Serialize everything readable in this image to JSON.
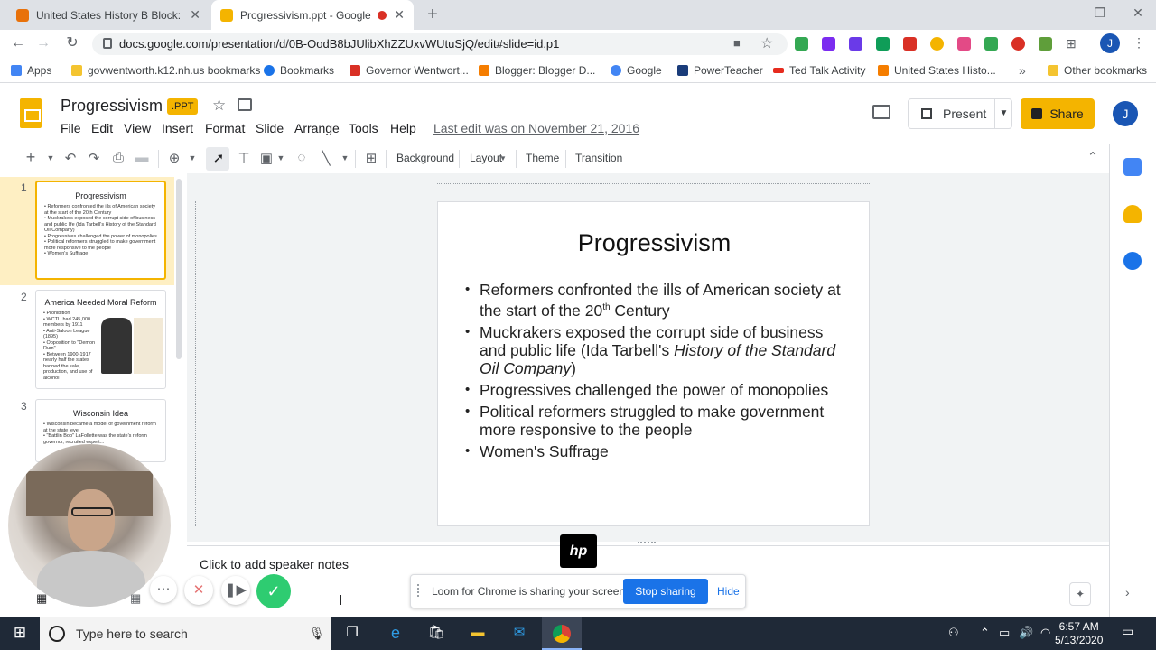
{
  "browser": {
    "tabs": [
      {
        "title": "United States History B Block: We",
        "favicon_color": "#e8710a"
      },
      {
        "title": "Progressivism.ppt - Google S",
        "favicon_color": "#f4b400"
      }
    ],
    "url": "docs.google.com/presentation/d/0B-OodB8bJUlibXhZZUxvWUtuSjQ/edit#slide=id.p1",
    "bookmarks": [
      {
        "label": "Apps",
        "icon": "apps-grid-icon"
      },
      {
        "label": "govwentworth.k12.nh.us bookmarks",
        "icon": "folder-icon"
      },
      {
        "label": "Bookmarks",
        "icon": "star-icon"
      },
      {
        "label": "Governor Wentwort...",
        "icon": "gmail-icon"
      },
      {
        "label": "Blogger: Blogger D...",
        "icon": "blogger-icon"
      },
      {
        "label": "Google",
        "icon": "google-icon"
      },
      {
        "label": "PowerTeacher",
        "icon": "powerteacher-icon"
      },
      {
        "label": "Ted Talk Activity",
        "icon": "ted-icon"
      },
      {
        "label": "United States Histo...",
        "icon": "blogger-icon"
      },
      {
        "label": "Other bookmarks",
        "icon": "folder-icon"
      }
    ],
    "profile_initial": "J"
  },
  "slides_app": {
    "doc_title": "Progressivism",
    "format_badge": ".PPT",
    "menu": [
      "File",
      "Edit",
      "View",
      "Insert",
      "Format",
      "Slide",
      "Arrange",
      "Tools",
      "Help"
    ],
    "last_edit": "Last edit was on November 21, 2016",
    "present_label": "Present",
    "share_label": "Share",
    "toolbar_text": {
      "background": "Background",
      "layout": "Layout",
      "theme": "Theme",
      "transition": "Transition"
    }
  },
  "filmstrip": [
    {
      "number": "1",
      "title": "Progressivism",
      "body": "• Reformers confronted the ills of American society at the start of the 20th Century\n• Muckrakers exposed the corrupt side of business and public life (Ida Tarbell's History of the Standard Oil Company)\n• Progressives challenged the power of monopolies\n• Political reformers struggled to make government more responsive to the people\n• Women's Suffrage"
    },
    {
      "number": "2",
      "title": "America Needed Moral Reform",
      "body": "• Prohibition\n• WCTU had 245,000 members by 1911\n• Anti-Saloon League (1895)\n• Opposition to \"Demon Rum\"\n• Between 1900-1917 nearly half the states banned the sale, production, and use of alcohol"
    },
    {
      "number": "3",
      "title": "Wisconsin Idea",
      "body": "• Wisconsin became a model of government reform at the state level\n• \"Battlin Bob\" LaFollette was the state's reform governor, recruited expert..."
    }
  ],
  "current_slide": {
    "title": "Progressivism",
    "bullets": [
      "Reformers confronted the ills of American society at the start of the 20th Century",
      "Muckrakers exposed the corrupt side of business and public life (Ida Tarbell's History of the Standard Oil Company)",
      "Progressives challenged the power of monopolies",
      "Political reformers struggled to make government more responsive to the people",
      "Women's Suffrage"
    ]
  },
  "notes_placeholder": "Click to add speaker notes",
  "loom": {
    "message": "Loom for Chrome is sharing your screen.",
    "stop_label": "Stop sharing",
    "hide_label": "Hide"
  },
  "hp_logo": "hp",
  "taskbar": {
    "search_placeholder": "Type here to search",
    "time": "6:57 AM",
    "date": "5/13/2020"
  }
}
